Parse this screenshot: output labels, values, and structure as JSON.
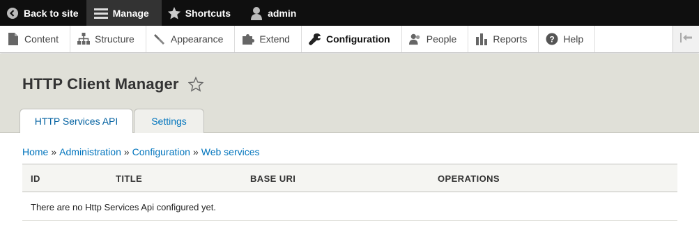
{
  "toolbar": {
    "back_to_site": "Back to site",
    "manage": "Manage",
    "shortcuts": "Shortcuts",
    "user": "admin"
  },
  "tray": {
    "items": [
      {
        "label": "Content",
        "icon": "file-icon"
      },
      {
        "label": "Structure",
        "icon": "sitemap-icon"
      },
      {
        "label": "Appearance",
        "icon": "paintbrush-icon"
      },
      {
        "label": "Extend",
        "icon": "puzzle-icon"
      },
      {
        "label": "Configuration",
        "icon": "wrench-icon"
      },
      {
        "label": "People",
        "icon": "people-icon"
      },
      {
        "label": "Reports",
        "icon": "bar-chart-icon"
      },
      {
        "label": "Help",
        "icon": "help-icon"
      }
    ],
    "active": "Configuration"
  },
  "page": {
    "title": "HTTP Client Manager"
  },
  "tabs": [
    {
      "label": "HTTP Services API",
      "active": true
    },
    {
      "label": "Settings",
      "active": false
    }
  ],
  "breadcrumb": {
    "items": [
      "Home",
      "Administration",
      "Configuration",
      "Web services"
    ],
    "separator": "»"
  },
  "table": {
    "headers": [
      "ID",
      "TITLE",
      "BASE URI",
      "OPERATIONS"
    ],
    "empty_message": "There are no Http Services Api configured yet."
  },
  "colors": {
    "toolbar_bg": "#0f0f0f",
    "header_bg": "#e0e0d8",
    "link": "#0074bd"
  }
}
